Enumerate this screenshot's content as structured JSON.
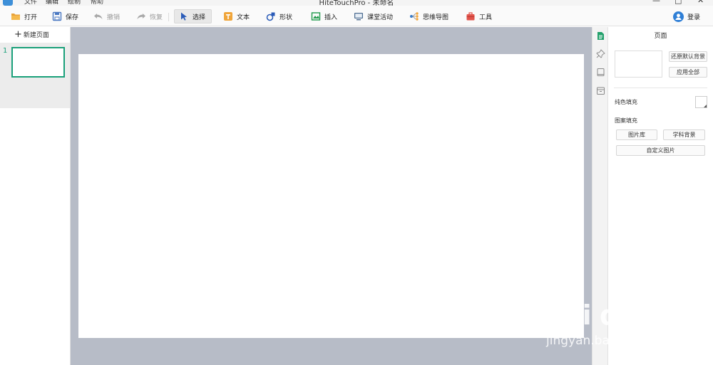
{
  "app": {
    "title": "HiteTouchPro - 未命名",
    "menu": [
      "文件",
      "编辑",
      "绘制",
      "帮助"
    ],
    "window_controls": [
      "—",
      "□",
      "✕"
    ]
  },
  "toolbar": {
    "open": "打开",
    "save": "保存",
    "undo": "撤销",
    "redo": "恢复",
    "select": "选择",
    "text": "文本",
    "shape": "形状",
    "insert": "插入",
    "classroom_activity": "课堂活动",
    "mind_map": "思维导图",
    "tools": "工具",
    "login": "登录"
  },
  "thumbs": {
    "new_page": "新建页面",
    "pages": [
      {
        "number": "1"
      }
    ]
  },
  "props": {
    "panel_title": "页面",
    "restore_default_bg": "还原默认背景",
    "apply_all": "应用全部",
    "solid_fill": "纯色填充",
    "pattern_fill": "图案填充",
    "image_library": "图片库",
    "subject_bg": "学科背景",
    "custom_image": "自定义图片"
  },
  "watermark": {
    "brand": "Bai du",
    "brand_cn": "经验",
    "url": "jingyan.baidu.com"
  },
  "colors": {
    "accent_green": "#1aa07a",
    "canvas_bg": "#b7bcc7",
    "active_tab": "#22a06b"
  },
  "icons": {
    "open": "folder-icon",
    "save": "floppy-icon",
    "undo": "undo-arrow-icon",
    "redo": "redo-arrow-icon",
    "select": "cursor-arrow-icon",
    "text": "text-T-icon",
    "shape": "shape-icon",
    "insert": "insert-image-icon",
    "classroom_activity": "monitor-icon",
    "mind_map": "mindmap-icon",
    "tools": "toolbox-icon",
    "login": "user-avatar-icon"
  }
}
